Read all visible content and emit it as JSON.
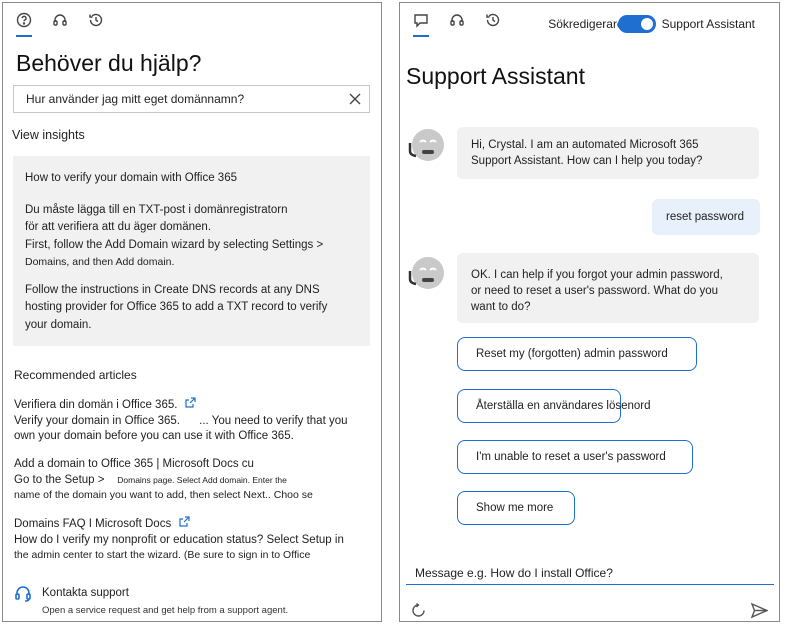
{
  "left_panel": {
    "tabs": [
      {
        "icon": "help-icon",
        "active": true
      },
      {
        "icon": "headset-icon",
        "active": false
      },
      {
        "icon": "history-icon",
        "active": false
      }
    ],
    "title": "Behöver du hjälp?",
    "search": {
      "value": "Hur använder jag mitt eget domännamn?"
    },
    "view_insights": "View insights",
    "insight": {
      "heading": "How to verify your domain with Office 365",
      "line1": "Du måste lägga till en TXT-post i domänregistratorn",
      "line2": "för att verifiera att du äger domänen.",
      "line3": "First, follow the Add Domain wizard by selecting Settings >",
      "line4": "Domains, and then Add domain.",
      "line5": "Follow the instructions in Create DNS records at any DNS",
      "line6": "hosting provider for Office 365 to add a TXT record to verify",
      "line7": "your domain."
    },
    "recommended_title": "Recommended articles",
    "articles": [
      {
        "title": "Verifiera din domän i Office 365.",
        "line1a": "Verify your domain in Office 365.",
        "line1b": "... You need to verify that you",
        "line2": "own your domain before you can use it with Office 365."
      },
      {
        "title": "Add a domain to Office 365 | Microsoft Docs cu",
        "line1a": "Go to the Setup >",
        "line1b": "Domains page. Select Add domain. Enter the",
        "line2": "name of the domain you want to add, then select Next.. Choo se"
      },
      {
        "title": "Domains FAQ I Microsoft Docs",
        "line1": "How do I verify my nonprofit or education status? Select Setup in",
        "line2": "the admin center to start the wizard. (Be sure to sign in to Office"
      }
    ],
    "contact": {
      "label": "Kontakta support",
      "sub": "Open a service request and get help from a support agent."
    }
  },
  "right_panel": {
    "tabs": [
      {
        "icon": "chat-icon",
        "active": true
      },
      {
        "icon": "headset-icon",
        "active": false
      },
      {
        "icon": "history-icon",
        "active": false
      }
    ],
    "toggle_label": "Sökredigerare",
    "toggle_on": true,
    "assistant_label": "Support Assistant",
    "title": "Support Assistant",
    "messages": {
      "bot1_line1": "Hi, Crystal. I am an automated Microsoft 365",
      "bot1_line2": "Support Assistant. How can I help you today?",
      "user1": "reset password",
      "bot2_line1": "OK. I can help if you forgot your admin password,",
      "bot2_line2": "or need to reset a user's password. What do you",
      "bot2_line3": "want to do?"
    },
    "options": [
      "Reset my (forgotten) admin password",
      "Återställa en användares lösenord",
      "I'm unable to reset a user's password",
      "Show me more"
    ],
    "input_placeholder": "Message e.g. How do I install Office?"
  },
  "colors": {
    "accent": "#1f6fd1",
    "insight_bg": "#f1f1f1",
    "user_bubble": "#e7f0fb"
  }
}
